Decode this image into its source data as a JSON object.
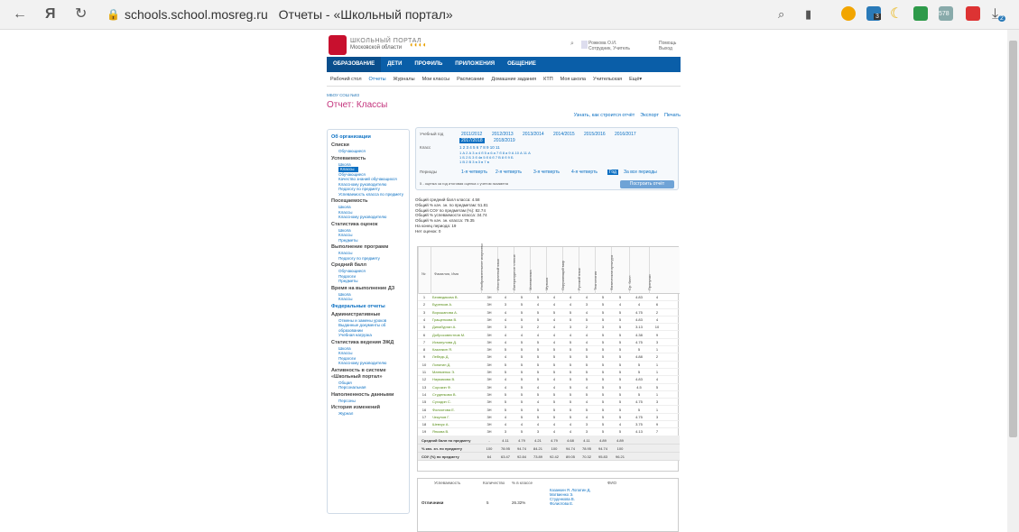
{
  "browser": {
    "domain": "schools.school.mosreg.ru",
    "title": "Отчеты - «Школьный портал»",
    "badges": {
      "b1": "3",
      "b2": "578",
      "b3": "2"
    }
  },
  "header": {
    "brand_line1": "ШКОЛЬНЫЙ ПОРТАЛ",
    "brand_line2": "Московской области",
    "user_name": "Рожкова О.И.",
    "user_role": "Сотрудник, Учитель",
    "help": "Помощь",
    "exit": "Выход"
  },
  "topnav": [
    "ОБРАЗОВАНИЕ",
    "ДЕТИ",
    "ПРОФИЛЬ",
    "ПРИЛОЖЕНИЯ",
    "ОБЩЕНИЕ"
  ],
  "subnav": [
    "Рабочий стол",
    "Отчеты",
    "Журналы",
    "Мои классы",
    "Расписание",
    "Домашние задания",
    "КТП",
    "Моя школа",
    "Учительская",
    "Ещё▾"
  ],
  "breadcrumb": "МБОУ СОШ №83",
  "page_title": "Отчет: Классы",
  "top_links": {
    "how": "Узнать, как строится отчёт",
    "export": "Экспорт",
    "print": "Печать"
  },
  "sidebar": [
    {
      "h": "Об организации",
      "items": []
    },
    {
      "h": "Списки",
      "items": [
        "Обучающиеся"
      ]
    },
    {
      "h": "Успеваемость",
      "items": [
        "Школа",
        "Классы",
        "Обучающиеся",
        "Качество знаний обучающихся",
        "Классному руководителю",
        "Педагогу по предмету",
        "Успеваемость класса по предмету"
      ]
    },
    {
      "h": "Посещаемость",
      "items": [
        "Школа",
        "Классы",
        "Классному руководителю"
      ]
    },
    {
      "h": "Статистика оценок",
      "items": [
        "Школа",
        "Классы",
        "Предметы"
      ]
    },
    {
      "h": "Выполнение программ",
      "items": [
        "Классы",
        "Педагогу по предмету"
      ]
    },
    {
      "h": "Средний балл",
      "items": [
        "Обучающиеся",
        "Педагоги",
        "Предметы"
      ]
    },
    {
      "h": "Время на выполнение ДЗ",
      "items": [
        "Школа",
        "Классы"
      ]
    },
    {
      "h": "Федеральные отчеты",
      "items": []
    },
    {
      "h": "Административные",
      "items": [
        "Отмены и замены уроков",
        "Выданные документы об образовании",
        "Учебная нагрузка"
      ]
    },
    {
      "h": "Статистика ведения ЭЖД",
      "items": [
        "Школа",
        "Классы",
        "Педагоги",
        "Классному руководителю"
      ]
    },
    {
      "h": "Активность в системе «Школьный портал»",
      "items": [
        "Общая",
        "Персональная"
      ]
    },
    {
      "h": "Наполненность данными",
      "items": [
        "Персоны"
      ]
    },
    {
      "h": "История изменений",
      "items": [
        "Журнал"
      ]
    }
  ],
  "filter": {
    "year_label": "Учебный год",
    "years": [
      "2011/2012",
      "2012/2013",
      "2013/2014",
      "2014/2015",
      "2015/2016",
      "2016/2017",
      "2017/2018",
      "2018/2019"
    ],
    "class_label": "Класс",
    "class_nums": "1  2  3  4  5  6  7  8  9  10  11",
    "class_row1": "1 А  2 А  3 а  4 б  5 а  6 а  7 б  8 а  9 А  10 А  11 А",
    "class_row2": "1 Б  2 Б  3 б  4в  5 б  6 б  7 В  8 б  9 Б",
    "class_row3": "1 В  2 В  3 в  3 в  7 в",
    "periods_label": "Периоды",
    "periods": [
      "1-я четверть",
      "2-я четверть",
      "3-я четверть",
      "4-я четверть",
      "Год",
      "За все периоды"
    ],
    "legend": "5 - оценка за год   итоговая оценка с учетом экзамена",
    "button": "Построить отчёт"
  },
  "stats": [
    "Общий средний балл класса: 4.58",
    "Общий % кач. зн. по предметам: 51.81",
    "Общий СОУ по предметам (%): 82.74",
    "Общий % успеваемости класса: 34.74",
    "Общий % кач. зн. класса: 79.35",
    "На конец периода: 19",
    "Нет оценок: 0"
  ],
  "table": {
    "headers": [
      "№",
      "Фамилия, Имя",
      "Изобразительное искусство",
      "Иностранный язык",
      "Литературное чтение",
      "Математика",
      "Музыка",
      "Окружающий мир",
      "Русский язык",
      "Технология",
      "Физическая культура",
      "Ср. балл",
      "Пропуски"
    ],
    "rows": [
      [
        "1",
        "Безведикова В.",
        "3Н",
        "4",
        "5",
        "5",
        "4",
        "4",
        "4",
        "5",
        "5",
        "4.83",
        "4"
      ],
      [
        "2",
        "Буренков А.",
        "3Н",
        "3",
        "5",
        "4",
        "4",
        "4",
        "3",
        "5",
        "4",
        "4",
        "6"
      ],
      [
        "3",
        "Воркшанова А.",
        "3Н",
        "4",
        "5",
        "5",
        "5",
        "5",
        "4",
        "5",
        "5",
        "4.75",
        "2"
      ],
      [
        "4",
        "Гращенкова В.",
        "3Н",
        "4",
        "5",
        "5",
        "4",
        "5",
        "5",
        "5",
        "5",
        "4.83",
        "4"
      ],
      [
        "5",
        "Динабурган А.",
        "3Н",
        "3",
        "3",
        "2",
        "4",
        "3",
        "2",
        "3",
        "5",
        "3.13",
        "10"
      ],
      [
        "6",
        "Добросовестнов М.",
        "3Н",
        "4",
        "4",
        "4",
        "4",
        "4",
        "4",
        "5",
        "5",
        "4.38",
        "9"
      ],
      [
        "7",
        "Исмагулова Д.",
        "3Н",
        "4",
        "5",
        "5",
        "4",
        "5",
        "4",
        "5",
        "5",
        "4.75",
        "3"
      ],
      [
        "8",
        "Казанкин Я.",
        "3Н",
        "5",
        "5",
        "5",
        "5",
        "5",
        "5",
        "5",
        "5",
        "5",
        "1"
      ],
      [
        "9",
        "Лебедь Д.",
        "3Н",
        "4",
        "5",
        "5",
        "5",
        "5",
        "5",
        "5",
        "5",
        "4.88",
        "2"
      ],
      [
        "10",
        "Лопатин Д.",
        "3Н",
        "5",
        "5",
        "5",
        "5",
        "5",
        "5",
        "5",
        "5",
        "5",
        "1"
      ],
      [
        "11",
        "Матвиенко Э.",
        "3Н",
        "5",
        "5",
        "5",
        "5",
        "5",
        "5",
        "5",
        "5",
        "5",
        "1"
      ],
      [
        "12",
        "Наумикова В.",
        "3Н",
        "4",
        "5",
        "5",
        "4",
        "5",
        "5",
        "5",
        "5",
        "4.83",
        "4"
      ],
      [
        "13",
        "Сорокин Ф.",
        "3Н",
        "4",
        "5",
        "4",
        "4",
        "5",
        "4",
        "5",
        "5",
        "4.5",
        "5"
      ],
      [
        "14",
        "Студенкова В.",
        "3Н",
        "5",
        "5",
        "5",
        "5",
        "5",
        "5",
        "5",
        "5",
        "5",
        "1"
      ],
      [
        "15",
        "Суходин С.",
        "3Н",
        "5",
        "5",
        "4",
        "5",
        "5",
        "4",
        "5",
        "5",
        "4.75",
        "3"
      ],
      [
        "16",
        "Фолиотова Е.",
        "3Н",
        "5",
        "5",
        "5",
        "5",
        "5",
        "5",
        "5",
        "5",
        "5",
        "1"
      ],
      [
        "17",
        "Чекунов Г.",
        "3Н",
        "4",
        "5",
        "5",
        "5",
        "5",
        "4",
        "5",
        "5",
        "4.75",
        "3"
      ],
      [
        "18",
        "Шевчук А.",
        "3Н",
        "4",
        "4",
        "4",
        "4",
        "4",
        "3",
        "5",
        "4",
        "3.75",
        "9"
      ],
      [
        "19",
        "Янкова В.",
        "3Н",
        "3",
        "5",
        "3",
        "4",
        "4",
        "3",
        "5",
        "5",
        "4.13",
        "7"
      ]
    ],
    "footer": [
      [
        "Средний балл по предмету",
        "-",
        "4.11",
        "4.79",
        "4.21",
        "4.79",
        "4.68",
        "4.11",
        "4.89",
        "4.89",
        "",
        ""
      ],
      [
        "% кач. зн. по предмету",
        "100",
        "78.95",
        "94.74",
        "84.21",
        "100",
        "94.74",
        "78.95",
        "94.74",
        "100",
        "",
        ""
      ],
      [
        "СОУ (%) по предмету",
        "64",
        "63.47",
        "92.84",
        "73.89",
        "92.42",
        "89.05",
        "70.32",
        "95.83",
        "96.21",
        "",
        ""
      ]
    ]
  },
  "perf": {
    "headers": [
      "Успеваемость",
      "Количество",
      "% в классе",
      "ФИО"
    ],
    "label": "Отличники",
    "count": "5",
    "pct": "26.32%",
    "names": "Казанкин Я. Лопатин Д. Матвиенко Э. Студенкова В. Фолиотова Е."
  }
}
